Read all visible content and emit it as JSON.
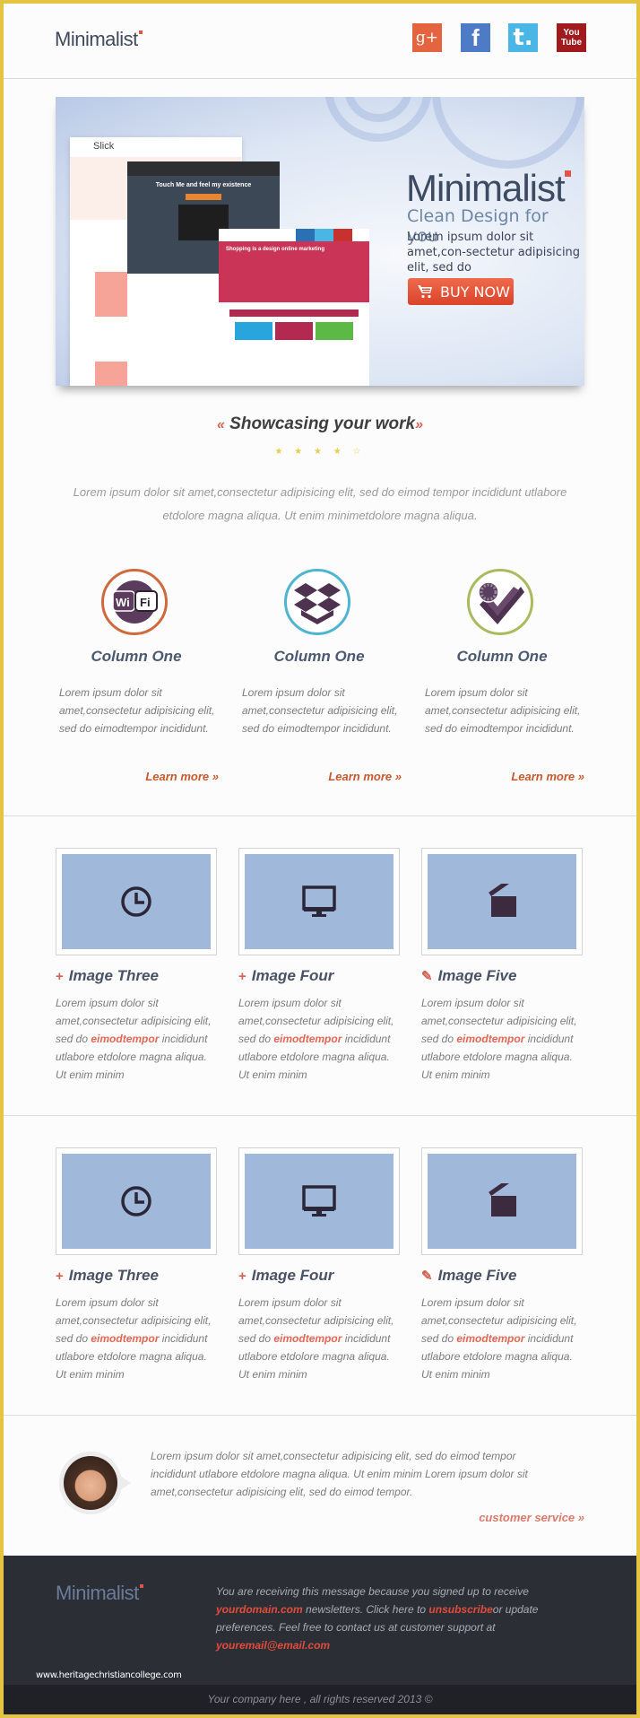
{
  "header": {
    "logo_text": "Minimalist",
    "social": [
      {
        "name": "google-plus",
        "glyph": "g+"
      },
      {
        "name": "facebook",
        "glyph": "f"
      },
      {
        "name": "tumblr",
        "glyph": "t."
      },
      {
        "name": "youtube",
        "glyph_line1": "You",
        "glyph_line2": "Tube"
      }
    ]
  },
  "hero": {
    "title": "Minimalist",
    "subtitle": "Clean Design for you",
    "text": "Lorem ipsum dolor sit amet,con-sectetur adipisicing elit, sed do",
    "buy_label": "BUY NOW",
    "mockups": {
      "slick_label": "Slick",
      "touch_title": "Touch Me and feel my existence",
      "shopping_title": "Shopping is a design online marketing"
    }
  },
  "showcase": {
    "title": "Showcasing your work",
    "quote_left": "«",
    "quote_right": "»",
    "rating": {
      "value": 4,
      "max": 5,
      "filled": "★ ★ ★ ★",
      "empty": "☆"
    },
    "intro": "Lorem ipsum dolor sit amet,consectetur adipisicing elit, sed do eimod tempor incididunt utlabore etdolore magna aliqua. Ut enim minimetdolore magna aliqua."
  },
  "columns": [
    {
      "icon": "wifi-icon",
      "ring_color": "#d0693d",
      "title": "Column One",
      "text": "Lorem ipsum dolor sit amet,consectetur adipisicing elit, sed do eimodtempor incididunt.",
      "link": "Learn more »"
    },
    {
      "icon": "dropbox-icon",
      "ring_color": "#4db5d0",
      "title": "Column One",
      "text": "Lorem ipsum dolor sit amet,consectetur adipisicing elit, sed do eimodtempor incididunt.",
      "link": "Learn more »"
    },
    {
      "icon": "forrst-icon",
      "ring_color": "#a9bb5f",
      "title": "Column One",
      "text": "Lorem ipsum dolor sit amet,consectetur adipisicing elit, sed do eimodtempor incididunt.",
      "link": "Learn more »"
    }
  ],
  "image_rows": [
    [
      {
        "icon": "clock-icon",
        "bullet": "+",
        "title": "Image Three",
        "text_before": "Lorem ipsum dolor sit amet,consectetur adipisicing elit, sed do ",
        "highlight": "eimodtempor",
        "text_after": " incididunt utlabore etdolore magna aliqua. Ut enim minim"
      },
      {
        "icon": "monitor-icon",
        "bullet": "+",
        "title": "Image Four",
        "text_before": "Lorem ipsum dolor sit amet,consectetur adipisicing elit, sed do ",
        "highlight": "eimodtempor",
        "text_after": " incididunt utlabore etdolore magna aliqua. Ut enim minim"
      },
      {
        "icon": "clapperboard-icon",
        "bullet": "✎",
        "title": "Image Five",
        "text_before": "Lorem ipsum dolor sit amet,consectetur adipisicing elit, sed do ",
        "highlight": "eimodtempor",
        "text_after": " incididunt utlabore etdolore magna aliqua. Ut enim minim"
      }
    ],
    [
      {
        "icon": "clock-icon",
        "bullet": "+",
        "title": "Image Three",
        "text_before": "Lorem ipsum dolor sit amet,consectetur adipisicing elit, sed do ",
        "highlight": "eimodtempor",
        "text_after": " incididunt utlabore etdolore magna aliqua. Ut enim minim"
      },
      {
        "icon": "monitor-icon",
        "bullet": "+",
        "title": "Image Four",
        "text_before": "Lorem ipsum dolor sit amet,consectetur adipisicing elit, sed do ",
        "highlight": "eimodtempor",
        "text_after": " incididunt utlabore etdolore magna aliqua. Ut enim minim"
      },
      {
        "icon": "clapperboard-icon",
        "bullet": "✎",
        "title": "Image Five",
        "text_before": "Lorem ipsum dolor sit amet,consectetur adipisicing elit, sed do ",
        "highlight": "eimodtempor",
        "text_after": " incididunt utlabore etdolore magna aliqua. Ut enim minim"
      }
    ]
  ],
  "customer_service": {
    "text": "Lorem ipsum dolor sit amet,consectetur adipisicing elit, sed do eimod tempor incididunt utlabore etdolore magna aliqua. Ut enim minim Lorem ipsum dolor sit amet,consectetur adipisicing elit, sed do eimod tempor.",
    "link": "customer service »"
  },
  "footer": {
    "logo_text": "Minimalist",
    "text_1": "You are receiving this message because you signed up to receive ",
    "domain_link": "yourdomain.com",
    "text_2": " newsletters. Click here to ",
    "unsubscribe_link": "unsubscribe",
    "text_3": "or update preferences. Feel free to contact us at customer support at ",
    "email_link": "youremail@email.com",
    "watermark": "www.heritagechristiancollege.com",
    "copyright": "Your company here , all rights reserved 2013 ©"
  },
  "colors": {
    "accent": "#e05547",
    "link_orange": "#c8582f",
    "highlight": "#e26856",
    "image_placeholder": "#a0b8da",
    "footer_bg": "#2b2e35",
    "frame_border": "#e4c441"
  }
}
